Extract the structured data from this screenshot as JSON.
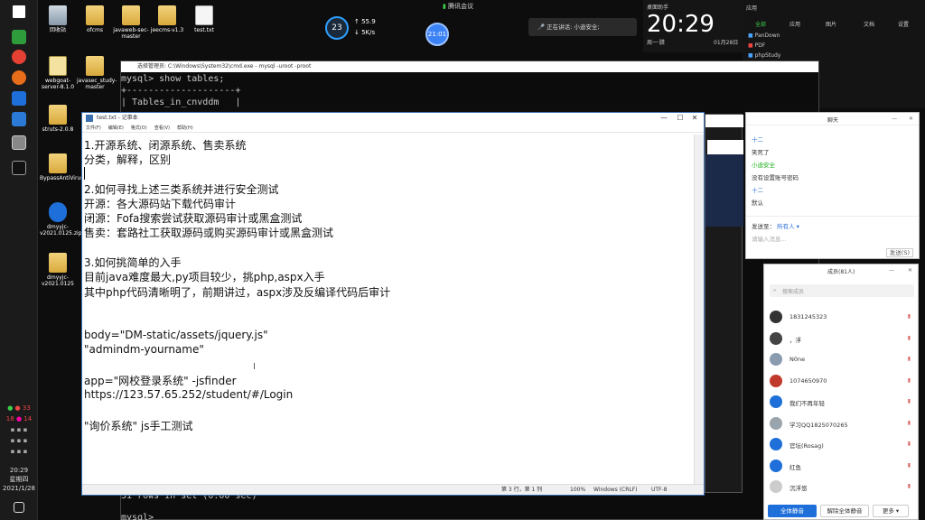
{
  "colors": {
    "accent": "#1e6fd9",
    "chat_green": "#1aad19",
    "chat_blue": "#2a6fd6"
  },
  "desktop": {
    "icons": [
      {
        "label": "回收站",
        "icon": "recycle-bin-icon"
      },
      {
        "label": "ofcms",
        "icon": "folder-icon"
      },
      {
        "label": "javaweb-sec-master",
        "icon": "folder-icon"
      },
      {
        "label": "jeecms-v1.3",
        "icon": "folder-icon"
      },
      {
        "label": "test.txt",
        "icon": "text-file-icon"
      },
      {
        "label": "webgoat-server-8.1.0",
        "icon": "jar-icon"
      },
      {
        "label": "javasec_study-master",
        "icon": "folder-icon"
      },
      {
        "label": "struts-2.0.8",
        "icon": "folder-icon"
      },
      {
        "label": "BypassAntiVirus",
        "icon": "folder-icon"
      },
      {
        "label": "dmyyjc-v2021.0125.zip",
        "icon": "zip-icon"
      },
      {
        "label": "dmyyjc-v2021.0125",
        "icon": "folder-icon"
      }
    ]
  },
  "top": {
    "cpu_percent": "23",
    "net_up": "55.9",
    "net_down": "5K/s",
    "meeting_label": "腾讯会议",
    "timer": "21:01",
    "speaking": "正在讲话: 小迪安全;"
  },
  "clock_widget": {
    "label": "桌面助手",
    "time": "20:29",
    "day": "周一·腊",
    "date": "01月28日"
  },
  "search_panel": {
    "tabs": [
      "全部",
      "应用",
      "图片",
      "文档",
      "设置"
    ],
    "recent_label": "应用",
    "items": [
      "PanDown",
      "PDF",
      "phpStudy"
    ]
  },
  "cmd": {
    "title": "选择管理员: C:\\Windows\\System32\\cmd.exe - mysql -uroot -proot",
    "lines": [
      "mysql> show tables;",
      "+--------------------+",
      "| Tables_in_cnvddm   |"
    ],
    "bottom_lines": [
      "31 rows in set (0.00 sec)",
      "",
      "mysql>"
    ]
  },
  "notepad": {
    "title": "test.txt - 记事本",
    "menu": [
      "文件(F)",
      "编辑(E)",
      "格式(O)",
      "查看(V)",
      "帮助(H)"
    ],
    "lines": [
      "1.开源系统、闭源系统、售卖系统",
      "分类，解释，区别",
      "",
      "2.如何寻找上述三类系统并进行安全测试",
      "开源：各大源码站下载代码审计",
      "闭源：Fofa搜索尝试获取源码审计或黑盒测试",
      "售卖：套路社工获取源码或购买源码审计或黑盒测试",
      "",
      "3.如何挑简单的入手",
      "目前java难度最大,py项目较少，挑php,aspx入手",
      "其中php代码清晰明了，前期讲过，aspx涉及反编译代码后审计",
      "",
      "",
      "body=\"DM-static/assets/jquery.js\"",
      "\"admindm-yourname\"",
      "",
      "app=\"网校登录系统\" -jsfinder",
      "https://123.57.65.252/student/#/Login",
      "",
      "\"询价系统\"  js手工测试"
    ],
    "status": {
      "position": "第 3 行，第 1 列",
      "zoom": "100%",
      "eol": "Windows (CRLF)",
      "encoding": "UTF-8"
    }
  },
  "chat": {
    "title": "聊天",
    "messages": [
      {
        "text": "十二",
        "color": "#2a6fd6"
      },
      {
        "text": "笑死了",
        "color": "#333333"
      },
      {
        "text": "小迪安全",
        "color": "#1aad19"
      },
      {
        "text": "没有设置账号密码",
        "color": "#333333"
      },
      {
        "text": "十二",
        "color": "#2a6fd6"
      },
      {
        "text": "默认",
        "color": "#333333"
      }
    ],
    "send_to_label": "发送至：",
    "send_to_value": "所有人",
    "input_placeholder": "请输入消息...",
    "send_button": "发送(S)"
  },
  "members": {
    "title": "成员(81人)",
    "search_placeholder": "搜索成员",
    "list": [
      {
        "name": "1831245323",
        "avatar": "#333333"
      },
      {
        "name": "，浮",
        "avatar": "#444444"
      },
      {
        "name": "N0ne",
        "avatar": "#8a9bb0"
      },
      {
        "name": "1074650970",
        "avatar": "#c0392b"
      },
      {
        "name": "我们不再年轻",
        "avatar": "#1e6fd9"
      },
      {
        "name": "学习QQ1825070265",
        "avatar": "#9aa4ad"
      },
      {
        "name": "官坛(Rosag)",
        "avatar": "#1e6fd9"
      },
      {
        "name": "红鱼",
        "avatar": "#1e6fd9"
      },
      {
        "name": "沉浮悠",
        "avatar": "#cccccc"
      }
    ],
    "mute_all_button": "全体静音",
    "unmute_all_button": "解除全体静音",
    "more_button": "更多"
  },
  "taskbar": {
    "time": "20:29",
    "weekday": "星期四",
    "date": "2021/1/28",
    "tray_numbers": [
      "33",
      "18",
      "14"
    ]
  }
}
